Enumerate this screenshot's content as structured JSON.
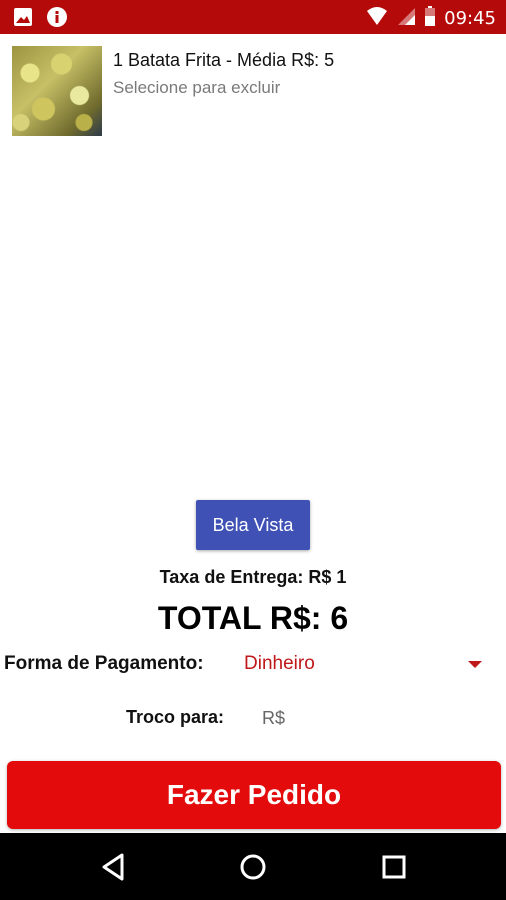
{
  "status_bar": {
    "time": "09:45",
    "left_icons": [
      "image-icon",
      "info-icon"
    ],
    "right_icons": [
      "wifi-icon",
      "signal-icon",
      "battery-icon"
    ]
  },
  "cart": {
    "items": [
      {
        "title": "1 Batata Frita - Média  R$: 5",
        "subtitle": "Selecione para excluir",
        "image": "fries-thumbnail"
      }
    ]
  },
  "delivery": {
    "region_button_label": "Bela Vista",
    "fee_text": "Taxa de Entrega:  R$ 1"
  },
  "total": {
    "text": "TOTAL R$: 6"
  },
  "payment": {
    "label": "Forma de Pagamento:",
    "selected": "Dinheiro"
  },
  "change": {
    "label": "Troco para:",
    "placeholder": "R$"
  },
  "order": {
    "button_label": "Fazer Pedido"
  },
  "nav_bar": {
    "buttons": [
      "back-icon",
      "home-icon",
      "recents-icon"
    ]
  },
  "colors": {
    "status_bar": "#b40a0a",
    "region_button": "#3f51b5",
    "order_button": "#e30b0b",
    "payment_value": "#c0181a"
  }
}
